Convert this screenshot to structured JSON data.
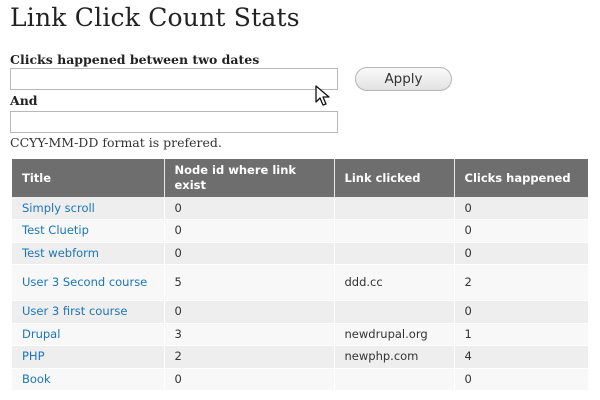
{
  "page": {
    "title": "Link Click Count Stats"
  },
  "form": {
    "start_label": "Clicks happened between two dates",
    "start_value": "",
    "end_label": "And",
    "end_value": "",
    "apply_label": "Apply",
    "help_text": "CCYY-MM-DD format is prefered."
  },
  "table": {
    "headers": [
      "Title",
      "Node id where link exist",
      "Link clicked",
      "Clicks happened"
    ],
    "rows": [
      {
        "title": "Simply scroll",
        "node_id": "0",
        "link": "",
        "clicks": "0"
      },
      {
        "title": "Test Cluetip",
        "node_id": "0",
        "link": "",
        "clicks": "0"
      },
      {
        "title": "Test webform",
        "node_id": "0",
        "link": "",
        "clicks": "0"
      },
      {
        "title": "User 3 Second course",
        "node_id": "5",
        "link": "ddd.cc",
        "clicks": "2"
      },
      {
        "title": "User 3 first course",
        "node_id": "0",
        "link": "",
        "clicks": "0"
      },
      {
        "title": "Drupal",
        "node_id": "3",
        "link": "newdrupal.org",
        "clicks": "1"
      },
      {
        "title": "PHP",
        "node_id": "2",
        "link": "newphp.com",
        "clicks": "4"
      },
      {
        "title": "Book",
        "node_id": "0",
        "link": "",
        "clicks": "0"
      }
    ]
  },
  "colors": {
    "header_bg": "#6e6e6e",
    "link": "#1b75bb",
    "row_odd": "#eeeeee",
    "row_even": "#f8f8f8"
  },
  "icons": {
    "cursor": "mouse-pointer-icon"
  }
}
